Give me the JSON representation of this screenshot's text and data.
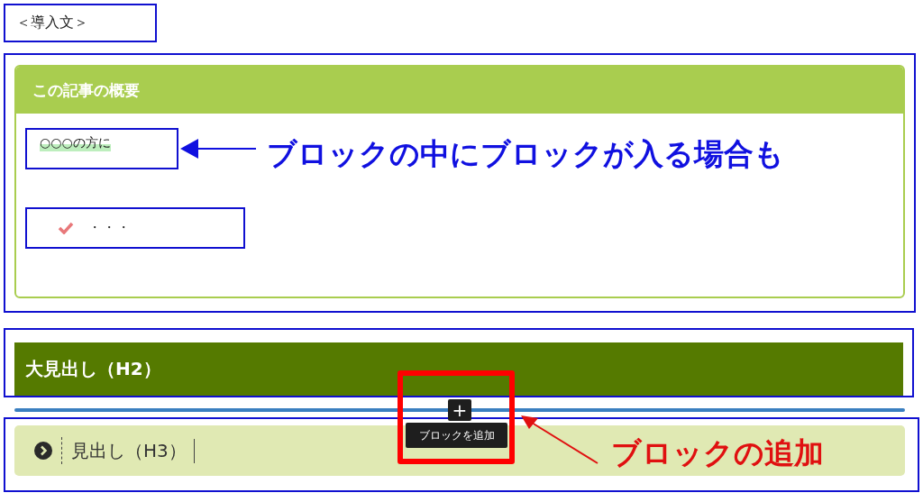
{
  "intro_block": {
    "text": "＜導入文＞"
  },
  "summary_box": {
    "title": "この記事の概要",
    "items": [
      {
        "kind": "highlight",
        "text": "○○○の方に"
      },
      {
        "kind": "check",
        "text": "・・・"
      }
    ]
  },
  "heading_h2": {
    "text": "大見出し（H2）"
  },
  "heading_h3": {
    "text": "見出し（H3）"
  },
  "inserter": {
    "button": "+",
    "tooltip": "ブロックを追加"
  },
  "annotations": [
    {
      "text": "ブロックの中にブロックが入る場合も",
      "color": "#1010e0"
    },
    {
      "text": "ブロックの追加",
      "color": "#e01010"
    }
  ]
}
